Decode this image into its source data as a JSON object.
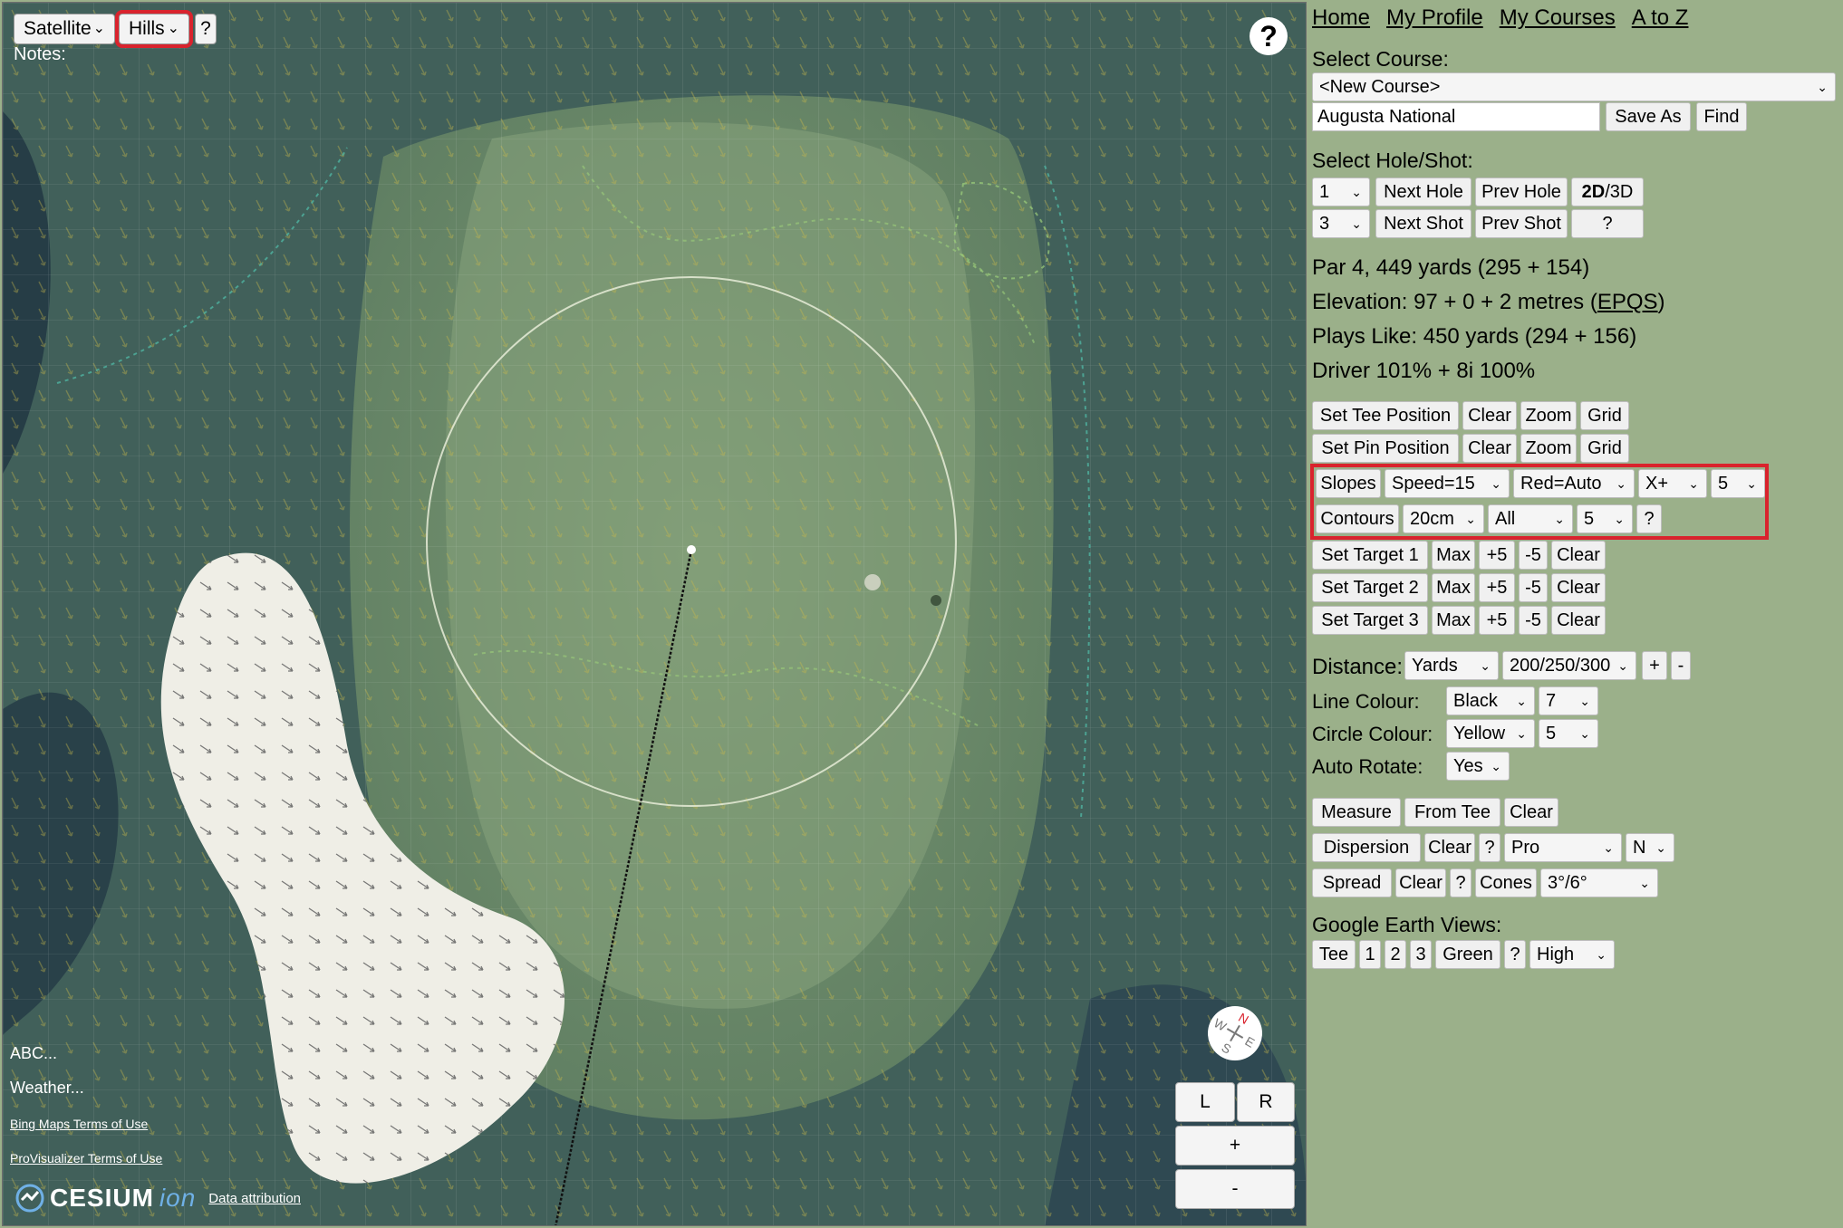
{
  "map": {
    "layer_select": "Satellite",
    "overlay_select": "Hills",
    "help_small": "?",
    "notes_label": "Notes:",
    "help_round": "?",
    "abc_label": "ABC...",
    "weather_label": "Weather...",
    "bing_terms": "Bing Maps Terms of Use",
    "provis_terms": "ProVisualizer Terms of Use",
    "cesium_brand": "CESIUM",
    "ion_brand": "ion",
    "data_attribution": "Data attribution",
    "rotate_left": "L",
    "rotate_right": "R",
    "zoom_in": "+",
    "zoom_out": "-",
    "compass_icon": "compass-icon"
  },
  "nav": {
    "home": "Home",
    "profile": "My Profile",
    "courses": "My Courses",
    "atoz": "A to Z"
  },
  "course": {
    "label": "Select Course:",
    "selected": "<New Course>",
    "name_value": "Augusta National",
    "save_as": "Save As",
    "find": "Find"
  },
  "hole": {
    "label": "Select Hole/Shot:",
    "hole_value": "1",
    "next_hole": "Next Hole",
    "prev_hole": "Prev Hole",
    "toggle_2d": "2D",
    "toggle_sep": "/3D",
    "shot_value": "3",
    "next_shot": "Next Shot",
    "prev_shot": "Prev Shot",
    "help": "?"
  },
  "stats": {
    "par_line": "Par 4, 449 yards (295 + 154)",
    "elevation_prefix": "Elevation: 97 + 0 + 2 metres (",
    "elevation_link": "EPQS",
    "elevation_suffix": ")",
    "plays_like": "Plays Like: 450 yards (294 + 156)",
    "driver": "Driver 101% + 8i 100%"
  },
  "positions": {
    "set_tee": "Set Tee Position",
    "set_pin": "Set Pin Position",
    "clear": "Clear",
    "zoom": "Zoom",
    "grid": "Grid"
  },
  "slopes": {
    "slopes": "Slopes",
    "speed": "Speed=15",
    "red": "Red=Auto",
    "axis": "X+",
    "density": "5",
    "contours": "Contours",
    "interval": "20cm",
    "scope": "All",
    "count": "5",
    "help": "?"
  },
  "targets": {
    "t1": "Set Target 1",
    "t2": "Set Target 2",
    "t3": "Set Target 3",
    "max": "Max",
    "plus5": "+5",
    "minus5": "-5",
    "clear": "Clear"
  },
  "settings": {
    "distance_label": "Distance:",
    "distance_unit": "Yards",
    "distance_rings": "200/250/300",
    "plus": "+",
    "minus": "-",
    "line_colour_label": "Line Colour:",
    "line_colour": "Black",
    "line_width": "7",
    "circle_colour_label": "Circle Colour:",
    "circle_colour": "Yellow",
    "circle_width": "5",
    "auto_rotate_label": "Auto Rotate:",
    "auto_rotate": "Yes"
  },
  "tools": {
    "measure": "Measure",
    "from_tee": "From Tee",
    "clear": "Clear",
    "dispersion": "Dispersion",
    "help": "?",
    "pro": "Pro",
    "north": "N",
    "spread": "Spread",
    "cones": "Cones",
    "angles": "3°/6°"
  },
  "ge": {
    "label": "Google Earth Views:",
    "tee": "Tee",
    "v1": "1",
    "v2": "2",
    "v3": "3",
    "green": "Green",
    "help": "?",
    "quality": "High"
  }
}
